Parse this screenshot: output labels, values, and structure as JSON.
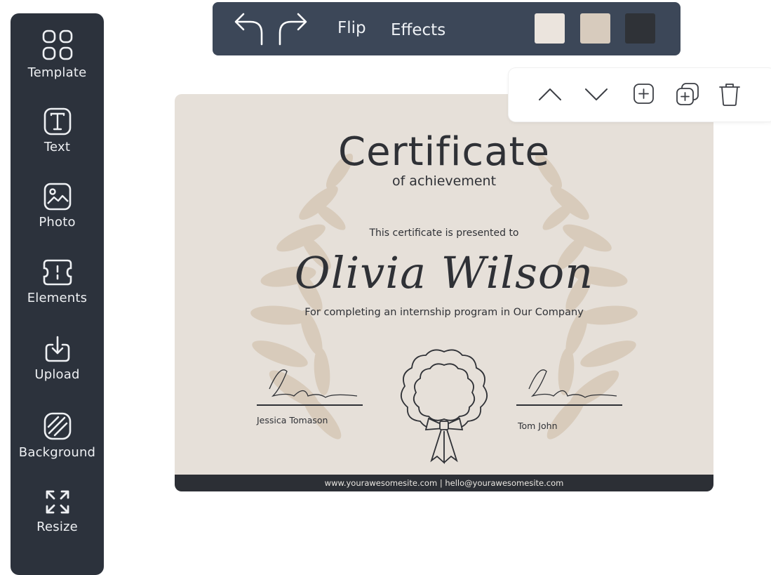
{
  "sidebar": {
    "items": [
      {
        "label": "Template",
        "icon": "template-grid-icon"
      },
      {
        "label": "Text",
        "icon": "text-icon"
      },
      {
        "label": "Photo",
        "icon": "photo-icon"
      },
      {
        "label": "Elements",
        "icon": "elements-icon"
      },
      {
        "label": "Upload",
        "icon": "upload-icon"
      },
      {
        "label": "Background",
        "icon": "background-icon"
      },
      {
        "label": "Resize",
        "icon": "resize-icon"
      }
    ]
  },
  "toolbar": {
    "undo_icon": "undo-icon",
    "redo_icon": "redo-icon",
    "flip_label": "Flip",
    "effects_label": "Effects",
    "swatches": [
      "#ebe4dd",
      "#d7cbbd",
      "#2f3237"
    ]
  },
  "element_toolbar": {
    "icons": [
      "chevron-up-icon",
      "chevron-down-icon",
      "add-icon",
      "duplicate-icon",
      "trash-icon"
    ]
  },
  "certificate": {
    "title": "Certificate",
    "subtitle": "of achievement",
    "presented": "This certificate is presented to",
    "recipient": "Olivia Wilson",
    "description": "For completing an internship program in Our Company",
    "signer_left": "Jessica Tomason",
    "signer_right": "Tom John",
    "footer": "www.yourawesomesite.com | hello@yourawesomesite.com",
    "background_color": "#e6e0d9",
    "laurel_color": "#d8cbbb",
    "ink_color": "#2f3136"
  }
}
